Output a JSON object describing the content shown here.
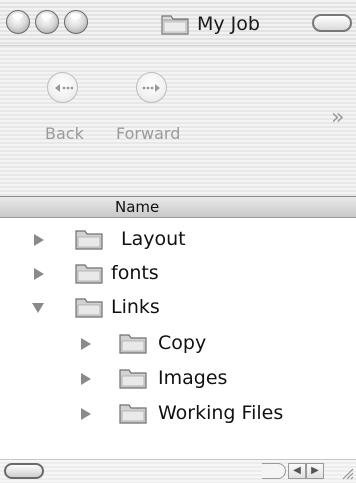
{
  "window": {
    "title": "My Job"
  },
  "toolbar": {
    "back_label": "Back",
    "forward_label": "Forward",
    "overflow_glyph": "»"
  },
  "list": {
    "column_header": "Name",
    "rows": [
      {
        "label": "Layout",
        "expanded": false,
        "level": 0,
        "icon": "folder-icon"
      },
      {
        "label": "fonts",
        "expanded": false,
        "level": 0,
        "icon": "folder-icon"
      },
      {
        "label": "Links",
        "expanded": true,
        "level": 0,
        "icon": "folder-icon"
      },
      {
        "label": "Copy",
        "expanded": false,
        "level": 1,
        "icon": "folder-icon"
      },
      {
        "label": "Images",
        "expanded": false,
        "level": 1,
        "icon": "folder-icon"
      },
      {
        "label": "Working Files",
        "expanded": false,
        "level": 1,
        "icon": "folder-icon"
      }
    ]
  },
  "scrollbar": {
    "left_arrow": "◀",
    "right_arrow": "▶"
  },
  "colors": {
    "window_chrome": "#e6e6e6",
    "header_gradient_top": "#e9e9e9",
    "header_gradient_bottom": "#c9c9c9",
    "disabled_text": "#9a9a9a",
    "folder_fill": "#d2d2d2"
  }
}
